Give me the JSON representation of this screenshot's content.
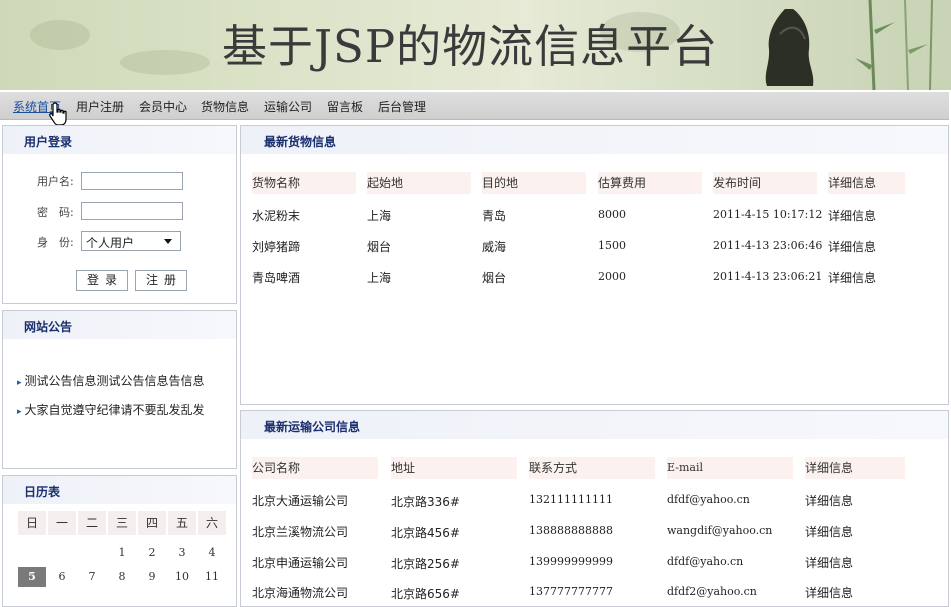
{
  "banner": {
    "title": "基于JSP的物流信息平台"
  },
  "nav": {
    "items": [
      "系统首页",
      "用户注册",
      "会员中心",
      "货物信息",
      "运输公司",
      "留言板",
      "后台管理"
    ]
  },
  "login": {
    "title": "用户登录",
    "username_label": "用户名:",
    "password_label": "密　码:",
    "role_label": "身　份:",
    "role_value": "个人用户",
    "login_button": "登录",
    "register_button": "注册"
  },
  "notices": {
    "title": "网站公告",
    "items": [
      "测试公告信息测试公告信息告信息",
      "大家自觉遵守纪律请不要乱发乱发"
    ]
  },
  "calendar": {
    "title": "日历表",
    "weekdays": [
      "日",
      "一",
      "二",
      "三",
      "四",
      "五",
      "六"
    ],
    "row1": [
      "",
      "",
      "",
      "1",
      "2",
      "3",
      "4"
    ],
    "row2": [
      "5",
      "6",
      "7",
      "8",
      "9",
      "10",
      "11"
    ],
    "today": "5"
  },
  "cargo": {
    "title": "最新货物信息",
    "headers": [
      "货物名称",
      "起始地",
      "目的地",
      "估算费用",
      "发布时间",
      "详细信息"
    ],
    "rows": [
      [
        "水泥粉末",
        "上海",
        "青岛",
        "8000",
        "2011-4-15 10:17:12",
        "详细信息"
      ],
      [
        "刘婷猪蹄",
        "烟台",
        "威海",
        "1500",
        "2011-4-13 23:06:46",
        "详细信息"
      ],
      [
        "青岛啤酒",
        "上海",
        "烟台",
        "2000",
        "2011-4-13 23:06:21",
        "详细信息"
      ]
    ]
  },
  "companies": {
    "title": "最新运输公司信息",
    "headers": [
      "公司名称",
      "地址",
      "联系方式",
      "E-mail",
      "详细信息"
    ],
    "rows": [
      [
        "北京大通运输公司",
        "北京路336#",
        "132111111111",
        "dfdf@yahoo.cn",
        "详细信息"
      ],
      [
        "北京兰溪物流公司",
        "北京路456#",
        "138888888888",
        "wangdif@yahoo.cn",
        "详细信息"
      ],
      [
        "北京申通运输公司",
        "北京路256#",
        "139999999999",
        "dfdf@yaho.cn",
        "详细信息"
      ],
      [
        "北京海通物流公司",
        "北京路656#",
        "137777777777",
        "dfdf2@yahoo.cn",
        "详细信息"
      ]
    ]
  }
}
